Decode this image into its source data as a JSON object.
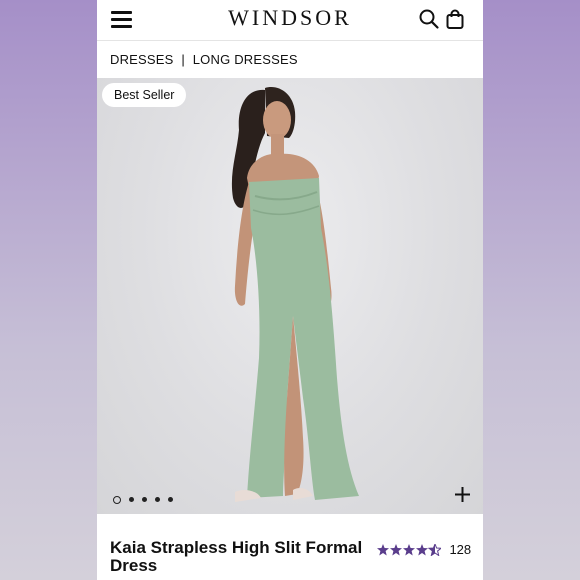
{
  "header": {
    "logo": "WINDSOR",
    "menu_icon": "hamburger-menu-icon",
    "search_icon": "search-icon",
    "bag_icon": "shopping-bag-icon"
  },
  "breadcrumb": {
    "items": [
      "DRESSES",
      "LONG DRESSES"
    ],
    "separator": "|"
  },
  "product": {
    "badge": "Best Seller",
    "image_count": 5,
    "active_image": 1,
    "zoom_icon": "plus-icon",
    "title": "Kaia Strapless High Slit Formal Dress",
    "rating": 4.5,
    "review_count": "128",
    "dress_color": "#9bbc9f"
  },
  "colors": {
    "star": "#5a3d8c",
    "background_gradient_top": "#a58fc8"
  }
}
